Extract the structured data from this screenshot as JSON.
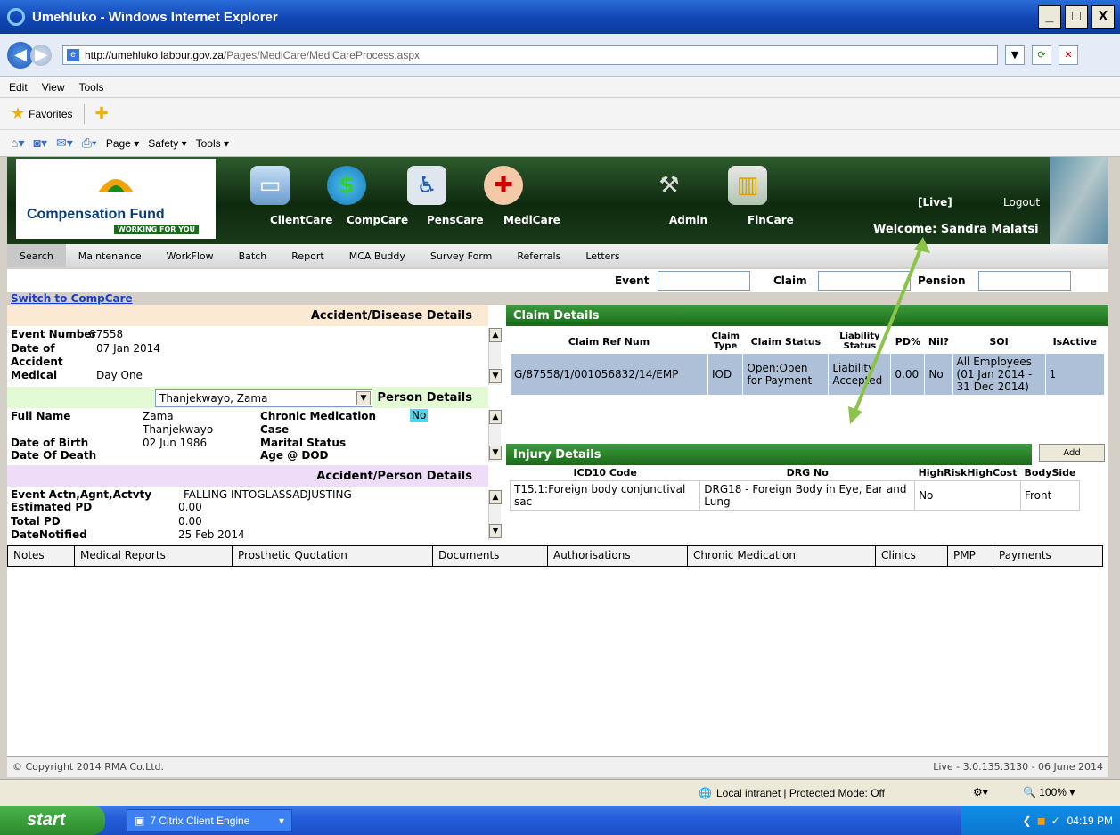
{
  "window": {
    "title": "Umehluko - Windows Internet Explorer",
    "min": "_",
    "max": "□",
    "close": "X"
  },
  "address": {
    "domain": "http://umehluko.labour.gov.za",
    "path": "/Pages/MediCare/MediCareProcess.aspx"
  },
  "menu": [
    "Edit",
    "View",
    "Tools"
  ],
  "favorites": {
    "label": "Favorites"
  },
  "commandbar": [
    "Page ▾",
    "Safety ▾",
    "Tools ▾"
  ],
  "app": {
    "logo_name": "Compensation Fund",
    "logo_tag": "WORKING FOR YOU",
    "modules": [
      "ClientCare",
      "CompCare",
      "PensCare",
      "MediCare",
      "Admin",
      "FinCare"
    ],
    "live": "[Live]",
    "logout": "Logout",
    "welcome": "Welcome: Sandra Malatsi"
  },
  "topmenu": [
    "Search",
    "Maintenance",
    "WorkFlow",
    "Batch",
    "Report",
    "MCA Buddy",
    "Survey Form",
    "Referrals",
    "Letters"
  ],
  "search": {
    "event": "Event",
    "claim": "Claim",
    "pension": "Pension"
  },
  "switch_link": "Switch to CompCare",
  "accident": {
    "header": "Accident/Disease Details",
    "event_number_label": "Event Number",
    "event_number": "87558",
    "date_label": "Date of",
    "date": "07 Jan 2014",
    "accident_label": "Accident",
    "medical_label": "Medical",
    "medical": "Day One"
  },
  "person": {
    "selected": "Thanjekwayo, Zama",
    "header": "Person Details",
    "full_name_label": "Full Name",
    "first_name": "Zama",
    "last_name": "Thanjekwayo",
    "chronic_label": "Chronic Medication",
    "chronic": "No",
    "case_label": "Case",
    "dob_label": "Date of Birth",
    "dob": "02 Jun 1986",
    "marital_label": "Marital Status",
    "dod_label": "Date Of Death",
    "age_dod_label": "Age @ DOD"
  },
  "accperson": {
    "header": "Accident/Person Details",
    "event_label": "Event Actn,Agnt,Actvty",
    "event": "FALLING INTOGLASSADJUSTING",
    "est_pd_label": "Estimated PD",
    "est_pd": "0.00",
    "total_pd_label": "Total PD",
    "total_pd": "0.00",
    "notified_label": "DateNotified",
    "notified": "25 Feb 2014"
  },
  "claim": {
    "header": "Claim Details",
    "cols": [
      "Claim Ref Num",
      "Claim Type",
      "Claim Status",
      "Liability Status",
      "PD%",
      "Nil?",
      "SOI",
      "IsActive"
    ],
    "row": [
      "G/87558/1/001056832/14/EMP",
      "IOD",
      "Open:Open for Payment",
      "Liability Accepted",
      "0.00",
      "No",
      "All Employees (01 Jan 2014 - 31 Dec 2014)",
      "1"
    ]
  },
  "injury": {
    "header": "Injury Details",
    "add": "Add",
    "cols": [
      "ICD10 Code",
      "DRG No",
      "HighRiskHighCost",
      "BodySide"
    ],
    "row": [
      "T15.1:Foreign body conjunctival sac",
      "DRG18 - Foreign Body in Eye, Ear and Lung",
      "No",
      "Front"
    ]
  },
  "bottabs": [
    "Notes",
    "Medical Reports",
    "Prosthetic Quotation",
    "Documents",
    "Authorisations",
    "Chronic Medication",
    "Clinics",
    "PMP",
    "Payments"
  ],
  "footer": {
    "copyright": "© Copyright 2014 RMA Co.Ltd.",
    "version": "Live - 3.0.135.3130 - 06 June 2014"
  },
  "status": {
    "zone": "Local intranet | Protected Mode: Off",
    "zoom": "100%"
  },
  "taskbar": {
    "start": "start",
    "task": "7 Citrix Client Engine",
    "time": "04:19 PM"
  },
  "colors": {
    "accent_green": "#1a6b1a",
    "arrow": "#8bc34a",
    "claim_row": "#adc0d8"
  }
}
